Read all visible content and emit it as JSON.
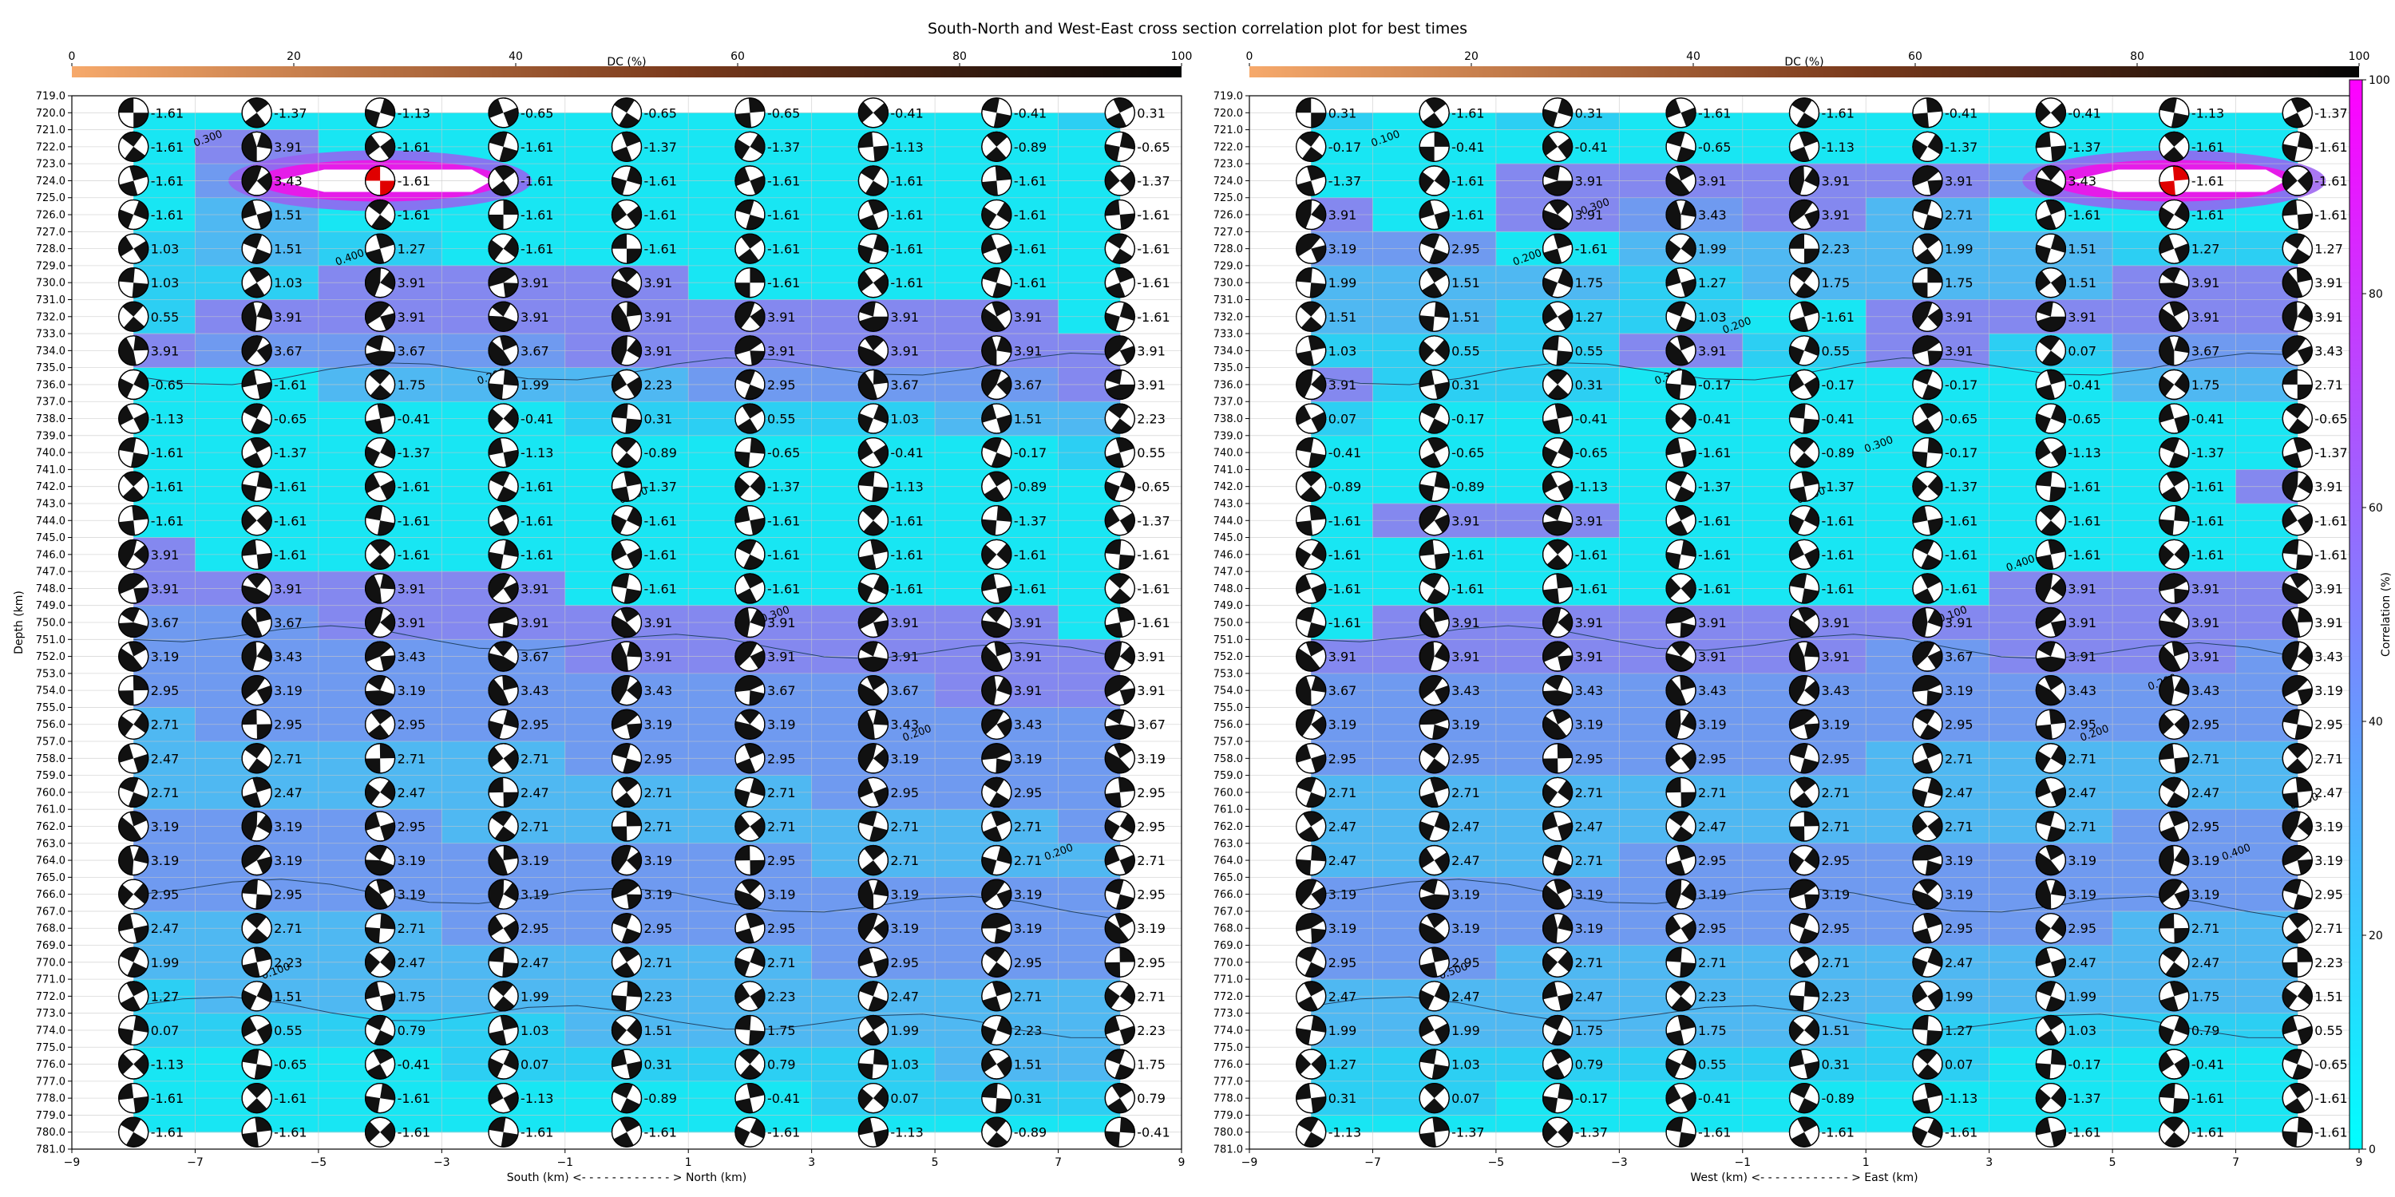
{
  "title": "South-North and West-East cross section correlation plot for best times",
  "colors": {
    "field_low": "#17e8f2",
    "field_mid": "#5aa9f0",
    "field_high": "#8a73ee",
    "peak": "#e51ce9",
    "dc_bar_start": "#f6a96b",
    "dc_bar_end": "#050505",
    "mechanism_fill": "#111111",
    "best_fill": "#e00000",
    "grid": "#c8c8c8",
    "contour": "#224466"
  },
  "chart_data": [
    {
      "type": "heatmap",
      "name": "south-north",
      "xlabel": "South (km) <- - - - - - - - - - - - > North (km)",
      "ylabel": "Depth (km)",
      "top_axis_label": "DC (%)",
      "top_ticks": [
        "0",
        "20",
        "40",
        "60",
        "80",
        "100"
      ],
      "xlim": [
        -9,
        9
      ],
      "xticks": [
        -9,
        -7,
        -5,
        -3,
        -1,
        1,
        3,
        5,
        7,
        9
      ],
      "ylim": [
        781,
        719
      ],
      "depth_ticks": [
        "719.0",
        "720.0",
        "721.0",
        "722.0",
        "723.0",
        "724.0",
        "725.0",
        "726.0",
        "727.0",
        "728.0",
        "729.0",
        "730.0",
        "731.0",
        "732.0",
        "733.0",
        "734.0",
        "735.0",
        "736.0",
        "737.0",
        "738.0",
        "739.0",
        "740.0",
        "741.0",
        "742.0",
        "743.0",
        "744.0",
        "745.0",
        "746.0",
        "747.0",
        "748.0",
        "749.0",
        "750.0",
        "751.0",
        "752.0",
        "753.0",
        "754.0",
        "755.0",
        "756.0",
        "757.0",
        "758.0",
        "759.0",
        "760.0",
        "761.0",
        "762.0",
        "763.0",
        "764.0",
        "765.0",
        "766.0",
        "767.0",
        "768.0",
        "769.0",
        "770.0",
        "771.0",
        "772.0",
        "773.0",
        "774.0",
        "775.0",
        "776.0",
        "777.0",
        "778.0",
        "779.0",
        "780.0",
        "781.0"
      ],
      "positions": [
        -8,
        -6,
        -4,
        -2,
        0,
        2,
        4,
        6,
        8
      ],
      "depths": [
        720,
        722,
        724,
        726,
        728,
        730,
        732,
        734,
        736,
        738,
        740,
        742,
        744,
        746,
        748,
        750,
        752,
        754,
        756,
        758,
        760,
        762,
        764,
        766,
        768,
        770,
        772,
        774,
        776,
        778,
        780
      ],
      "best": {
        "x": -4,
        "depth": 724,
        "label": "-1.61"
      },
      "contour_labels": [
        "0.300",
        "0.400",
        "0.200",
        "0.200",
        "0.300",
        "0.200",
        "0.200",
        "0.100"
      ],
      "values": [
        [
          "-1.61",
          "-1.37",
          "-1.13",
          "-0.65",
          "-0.65",
          "-0.65",
          "-0.41",
          "-0.41",
          "0.31"
        ],
        [
          "-1.61",
          "3.91",
          "-1.61",
          "-1.61",
          "-1.37",
          "-1.37",
          "-1.13",
          "-0.89",
          "-0.65"
        ],
        [
          "-1.61",
          "3.43",
          "-1.61",
          "-1.61",
          "-1.61",
          "-1.61",
          "-1.61",
          "-1.61",
          "-1.37"
        ],
        [
          "-1.61",
          "1.51",
          "-1.61",
          "-1.61",
          "-1.61",
          "-1.61",
          "-1.61",
          "-1.61",
          "-1.61"
        ],
        [
          "1.03",
          "1.51",
          "1.27",
          "-1.61",
          "-1.61",
          "-1.61",
          "-1.61",
          "-1.61",
          "-1.61"
        ],
        [
          "1.03",
          "1.03",
          "3.91",
          "3.91",
          "3.91",
          "-1.61",
          "-1.61",
          "-1.61",
          "-1.61"
        ],
        [
          "0.55",
          "3.91",
          "3.91",
          "3.91",
          "3.91",
          "3.91",
          "3.91",
          "3.91",
          "-1.61"
        ],
        [
          "3.91",
          "3.67",
          "3.67",
          "3.67",
          "3.91",
          "3.91",
          "3.91",
          "3.91",
          "3.91"
        ],
        [
          "-0.65",
          "-1.61",
          "1.75",
          "1.99",
          "2.23",
          "2.95",
          "3.67",
          "3.67",
          "3.91"
        ],
        [
          "-1.13",
          "-0.65",
          "-0.41",
          "-0.41",
          "0.31",
          "0.55",
          "1.03",
          "1.51",
          "2.23"
        ],
        [
          "-1.61",
          "-1.37",
          "-1.37",
          "-1.13",
          "-0.89",
          "-0.65",
          "-0.41",
          "-0.17",
          "0.55"
        ],
        [
          "-1.61",
          "-1.61",
          "-1.61",
          "-1.61",
          "-1.37",
          "-1.37",
          "-1.13",
          "-0.89",
          "-0.65"
        ],
        [
          "-1.61",
          "-1.61",
          "-1.61",
          "-1.61",
          "-1.61",
          "-1.61",
          "-1.61",
          "-1.37",
          "-1.37"
        ],
        [
          "3.91",
          "-1.61",
          "-1.61",
          "-1.61",
          "-1.61",
          "-1.61",
          "-1.61",
          "-1.61",
          "-1.61"
        ],
        [
          "3.91",
          "3.91",
          "3.91",
          "3.91",
          "-1.61",
          "-1.61",
          "-1.61",
          "-1.61",
          "-1.61"
        ],
        [
          "3.67",
          "3.67",
          "3.91",
          "3.91",
          "3.91",
          "3.91",
          "3.91",
          "3.91",
          "-1.61"
        ],
        [
          "3.19",
          "3.43",
          "3.43",
          "3.67",
          "3.91",
          "3.91",
          "3.91",
          "3.91",
          "3.91"
        ],
        [
          "2.95",
          "3.19",
          "3.19",
          "3.43",
          "3.43",
          "3.67",
          "3.67",
          "3.91",
          "3.91"
        ],
        [
          "2.71",
          "2.95",
          "2.95",
          "2.95",
          "3.19",
          "3.19",
          "3.43",
          "3.43",
          "3.67"
        ],
        [
          "2.47",
          "2.71",
          "2.71",
          "2.71",
          "2.95",
          "2.95",
          "3.19",
          "3.19",
          "3.19"
        ],
        [
          "2.71",
          "2.47",
          "2.47",
          "2.47",
          "2.71",
          "2.71",
          "2.95",
          "2.95",
          "2.95"
        ],
        [
          "3.19",
          "3.19",
          "2.95",
          "2.71",
          "2.71",
          "2.71",
          "2.71",
          "2.71",
          "2.95"
        ],
        [
          "3.19",
          "3.19",
          "3.19",
          "3.19",
          "3.19",
          "2.95",
          "2.71",
          "2.71",
          "2.71"
        ],
        [
          "2.95",
          "2.95",
          "3.19",
          "3.19",
          "3.19",
          "3.19",
          "3.19",
          "3.19",
          "2.95"
        ],
        [
          "2.47",
          "2.71",
          "2.71",
          "2.95",
          "2.95",
          "2.95",
          "3.19",
          "3.19",
          "3.19"
        ],
        [
          "1.99",
          "2.23",
          "2.47",
          "2.47",
          "2.71",
          "2.71",
          "2.95",
          "2.95",
          "2.95"
        ],
        [
          "1.27",
          "1.51",
          "1.75",
          "1.99",
          "2.23",
          "2.23",
          "2.47",
          "2.71",
          "2.71"
        ],
        [
          "0.07",
          "0.55",
          "0.79",
          "1.03",
          "1.51",
          "1.75",
          "1.99",
          "2.23",
          "2.23"
        ],
        [
          "-1.13",
          "-0.65",
          "-0.41",
          "0.07",
          "0.31",
          "0.79",
          "1.03",
          "1.51",
          "1.75"
        ],
        [
          "-1.61",
          "-1.61",
          "-1.61",
          "-1.13",
          "-0.89",
          "-0.41",
          "0.07",
          "0.31",
          "0.79"
        ],
        [
          "-1.61",
          "-1.61",
          "-1.61",
          "-1.61",
          "-1.61",
          "-1.61",
          "-1.13",
          "-0.89",
          "-0.41"
        ]
      ]
    },
    {
      "type": "heatmap",
      "name": "west-east",
      "xlabel": "West (km) <- - - - - - - - - - - - > East (km)",
      "ylabel": "",
      "top_axis_label": "DC (%)",
      "top_ticks": [
        "0",
        "20",
        "40",
        "60",
        "80",
        "100"
      ],
      "xlim": [
        -9,
        9
      ],
      "xticks": [
        -9,
        -7,
        -5,
        -3,
        -1,
        1,
        3,
        5,
        7,
        9
      ],
      "ylim": [
        781,
        719
      ],
      "depth_ticks": [
        "719.0",
        "720.0",
        "721.0",
        "722.0",
        "723.0",
        "724.0",
        "725.0",
        "726.0",
        "727.0",
        "728.0",
        "729.0",
        "730.0",
        "731.0",
        "732.0",
        "733.0",
        "734.0",
        "735.0",
        "736.0",
        "737.0",
        "738.0",
        "739.0",
        "740.0",
        "741.0",
        "742.0",
        "743.0",
        "744.0",
        "745.0",
        "746.0",
        "747.0",
        "748.0",
        "749.0",
        "750.0",
        "751.0",
        "752.0",
        "753.0",
        "754.0",
        "755.0",
        "756.0",
        "757.0",
        "758.0",
        "759.0",
        "760.0",
        "761.0",
        "762.0",
        "763.0",
        "764.0",
        "765.0",
        "766.0",
        "767.0",
        "768.0",
        "769.0",
        "770.0",
        "771.0",
        "772.0",
        "773.0",
        "774.0",
        "775.0",
        "776.0",
        "777.0",
        "778.0",
        "779.0",
        "780.0",
        "781.0"
      ],
      "positions": [
        -8,
        -6,
        -4,
        -2,
        0,
        2,
        4,
        6,
        8
      ],
      "depths": [
        720,
        722,
        724,
        726,
        728,
        730,
        732,
        734,
        736,
        738,
        740,
        742,
        744,
        746,
        748,
        750,
        752,
        754,
        756,
        758,
        760,
        762,
        764,
        766,
        768,
        770,
        772,
        774,
        776,
        778,
        780
      ],
      "best": {
        "x": 6,
        "depth": 724,
        "label": "-1.61"
      },
      "contour_labels": [
        "0.100",
        "0.200",
        "0.300",
        "0.400",
        "0.100",
        "0.200",
        "0.400",
        "0.500",
        "0.300",
        "0.200",
        "0.300",
        "0.400",
        "0.200",
        "0.300"
      ],
      "colorbar_label": "Correlation (%)",
      "colorbar_ticks": [
        "0",
        "20",
        "40",
        "60",
        "80",
        "100"
      ],
      "values": [
        [
          "0.31",
          "-1.61",
          "0.31",
          "-1.61",
          "-1.61",
          "-0.41",
          "-0.41",
          "-1.13",
          "-1.37"
        ],
        [
          "-0.17",
          "-0.41",
          "-0.41",
          "-0.65",
          "-1.13",
          "-1.37",
          "-1.37",
          "-1.61",
          "-1.61"
        ],
        [
          "-1.37",
          "-1.61",
          "3.91",
          "3.91",
          "3.91",
          "3.91",
          "3.43",
          "-1.61",
          "-1.61"
        ],
        [
          "3.91",
          "-1.61",
          "3.91",
          "3.43",
          "3.91",
          "2.71",
          "-1.61",
          "-1.61",
          "-1.61"
        ],
        [
          "3.19",
          "2.95",
          "-1.61",
          "1.99",
          "2.23",
          "1.99",
          "1.51",
          "1.27",
          "1.27"
        ],
        [
          "1.99",
          "1.51",
          "1.75",
          "1.27",
          "1.75",
          "1.75",
          "1.51",
          "3.91",
          "3.91"
        ],
        [
          "1.51",
          "1.51",
          "1.27",
          "1.03",
          "-1.61",
          "3.91",
          "3.91",
          "3.91",
          "3.91"
        ],
        [
          "1.03",
          "0.55",
          "0.55",
          "3.91",
          "0.55",
          "3.91",
          "0.07",
          "3.67",
          "3.43"
        ],
        [
          "3.91",
          "0.31",
          "0.31",
          "-0.17",
          "-0.17",
          "-0.17",
          "-0.41",
          "1.75",
          "2.71"
        ],
        [
          "0.07",
          "-0.17",
          "-0.41",
          "-0.41",
          "-0.41",
          "-0.65",
          "-0.65",
          "-0.41",
          "-0.65"
        ],
        [
          "-0.41",
          "-0.65",
          "-0.65",
          "-1.61",
          "-0.89",
          "-0.17",
          "-1.13",
          "-1.37",
          "-1.37"
        ],
        [
          "-0.89",
          "-0.89",
          "-1.13",
          "-1.37",
          "-1.37",
          "-1.37",
          "-1.61",
          "-1.61",
          "3.91"
        ],
        [
          "-1.61",
          "3.91",
          "3.91",
          "-1.61",
          "-1.61",
          "-1.61",
          "-1.61",
          "-1.61",
          "-1.61"
        ],
        [
          "-1.61",
          "-1.61",
          "-1.61",
          "-1.61",
          "-1.61",
          "-1.61",
          "-1.61",
          "-1.61",
          "-1.61"
        ],
        [
          "-1.61",
          "-1.61",
          "-1.61",
          "-1.61",
          "-1.61",
          "-1.61",
          "3.91",
          "3.91",
          "3.91"
        ],
        [
          "-1.61",
          "3.91",
          "3.91",
          "3.91",
          "3.91",
          "3.91",
          "3.91",
          "3.91",
          "3.91"
        ],
        [
          "3.91",
          "3.91",
          "3.91",
          "3.91",
          "3.91",
          "3.67",
          "3.91",
          "3.91",
          "3.43"
        ],
        [
          "3.67",
          "3.43",
          "3.43",
          "3.43",
          "3.43",
          "3.19",
          "3.43",
          "3.43",
          "3.19"
        ],
        [
          "3.19",
          "3.19",
          "3.19",
          "3.19",
          "3.19",
          "2.95",
          "2.95",
          "2.95",
          "2.95"
        ],
        [
          "2.95",
          "2.95",
          "2.95",
          "2.95",
          "2.95",
          "2.71",
          "2.71",
          "2.71",
          "2.71"
        ],
        [
          "2.71",
          "2.71",
          "2.71",
          "2.71",
          "2.71",
          "2.47",
          "2.47",
          "2.47",
          "2.47"
        ],
        [
          "2.47",
          "2.47",
          "2.47",
          "2.47",
          "2.71",
          "2.71",
          "2.71",
          "2.95",
          "3.19"
        ],
        [
          "2.47",
          "2.47",
          "2.71",
          "2.95",
          "2.95",
          "3.19",
          "3.19",
          "3.19",
          "3.19"
        ],
        [
          "3.19",
          "3.19",
          "3.19",
          "3.19",
          "3.19",
          "3.19",
          "3.19",
          "3.19",
          "2.95"
        ],
        [
          "3.19",
          "3.19",
          "3.19",
          "2.95",
          "2.95",
          "2.95",
          "2.95",
          "2.71",
          "2.71"
        ],
        [
          "2.95",
          "2.95",
          "2.71",
          "2.71",
          "2.71",
          "2.47",
          "2.47",
          "2.47",
          "2.23"
        ],
        [
          "2.47",
          "2.47",
          "2.47",
          "2.23",
          "2.23",
          "1.99",
          "1.99",
          "1.75",
          "1.51"
        ],
        [
          "1.99",
          "1.99",
          "1.75",
          "1.75",
          "1.51",
          "1.27",
          "1.03",
          "0.79",
          "0.55"
        ],
        [
          "1.27",
          "1.03",
          "0.79",
          "0.55",
          "0.31",
          "0.07",
          "-0.17",
          "-0.41",
          "-0.65"
        ],
        [
          "0.31",
          "0.07",
          "-0.17",
          "-0.41",
          "-0.89",
          "-1.13",
          "-1.37",
          "-1.61",
          "-1.61"
        ],
        [
          "-1.13",
          "-1.37",
          "-1.37",
          "-1.61",
          "-1.61",
          "-1.61",
          "-1.61",
          "-1.61",
          "-1.61"
        ]
      ]
    }
  ]
}
